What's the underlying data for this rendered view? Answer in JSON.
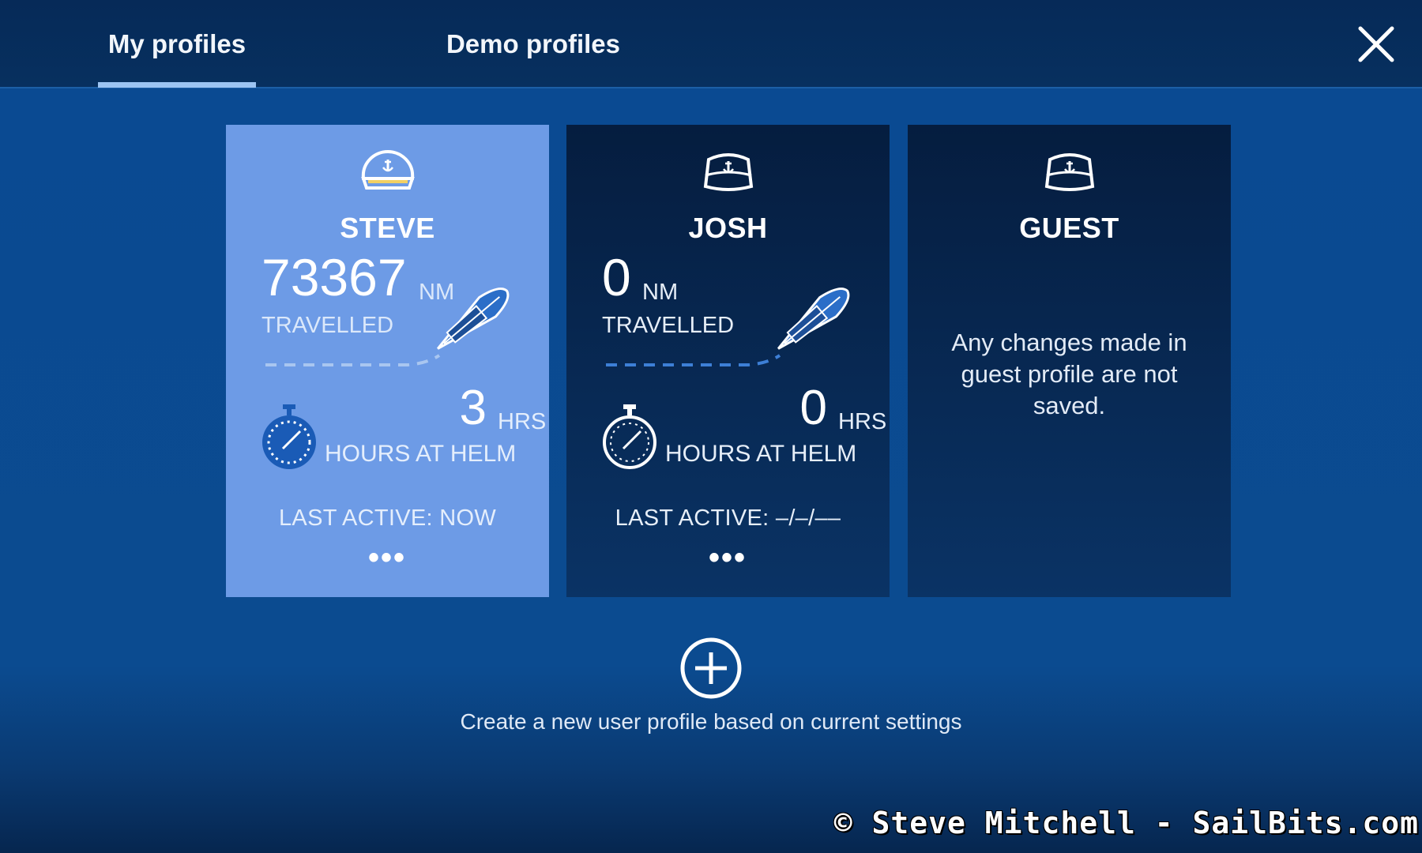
{
  "header": {
    "tabs": [
      {
        "label": "My profiles",
        "active": true
      },
      {
        "label": "Demo profiles",
        "active": false
      }
    ],
    "close_icon": "close-icon"
  },
  "profiles": [
    {
      "name": "STEVE",
      "distance_value": "73367",
      "distance_unit": "NM",
      "distance_label": "TRAVELLED",
      "hours_value": "3",
      "hours_unit": "HRS",
      "hours_label": "HOURS AT HELM",
      "last_active": "LAST ACTIVE: NOW",
      "more": "•••",
      "selected": true,
      "icon": "captain-hat-icon"
    },
    {
      "name": "JOSH",
      "distance_value": "0",
      "distance_unit": "NM",
      "distance_label": "TRAVELLED",
      "hours_value": "0",
      "hours_unit": "HRS",
      "hours_label": "HOURS AT HELM",
      "last_active": "LAST ACTIVE: –/–/––",
      "more": "•••",
      "selected": false,
      "icon": "sailor-hat-icon"
    },
    {
      "name": "GUEST",
      "message": "Any changes made in guest profile are not saved.",
      "selected": false,
      "icon": "sailor-hat-icon"
    }
  ],
  "create": {
    "label": "Create a new user profile based on current settings",
    "icon": "plus-circle-icon"
  },
  "watermark": "© Steve Mitchell - SailBits.com",
  "colors": {
    "background": "#0b4b90",
    "header": "#062a58",
    "selected_card": "#6d9be6",
    "card_dark": "#051d3f",
    "tab_underline": "#9cc4f2"
  }
}
